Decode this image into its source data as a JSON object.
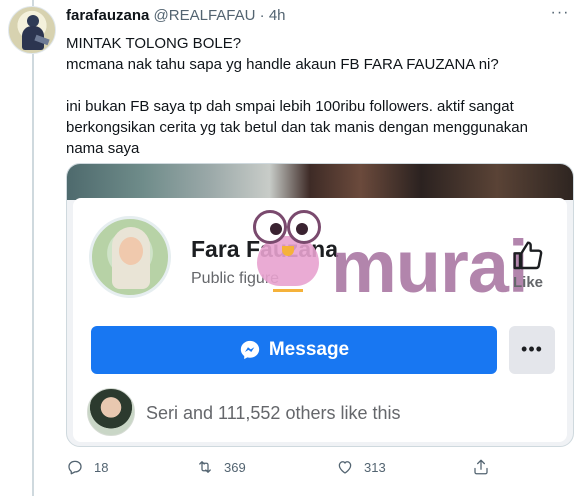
{
  "tweet": {
    "author_name": "farafauzana",
    "author_handle": "@REALFAFAU",
    "separator": "·",
    "time": "4h",
    "more_label": "···",
    "text_lines": [
      "MINTAK TOLONG BOLE?",
      "mcmana nak tahu sapa yg handle akaun FB FARA FAUZANA ni?",
      "ini bukan FB saya tp dah smpai lebih 100ribu followers. aktif sangat",
      "berkongsikan cerita yg tak betul dan tak manis dengan menggunakan",
      "nama saya"
    ]
  },
  "facebook_card": {
    "page_name": "Fara Fauzana",
    "category": "Public figure",
    "like_label": "Like",
    "message_button_label": "Message",
    "more_button_label": "•••",
    "likes_text": "Seri and 111,552 others like this"
  },
  "watermark": {
    "text": "murai",
    "color": "#a26b9b"
  },
  "actions": {
    "reply_count": "18",
    "retweet_count": "369",
    "like_count": "313"
  },
  "colors": {
    "facebook_blue": "#1877f2",
    "twitter_grey": "#536471"
  },
  "icons": {
    "reply": "reply-icon",
    "retweet": "retweet-icon",
    "like": "heart-icon",
    "share": "share-icon",
    "messenger": "messenger-icon",
    "thumbs_up": "thumbs-up-icon"
  }
}
